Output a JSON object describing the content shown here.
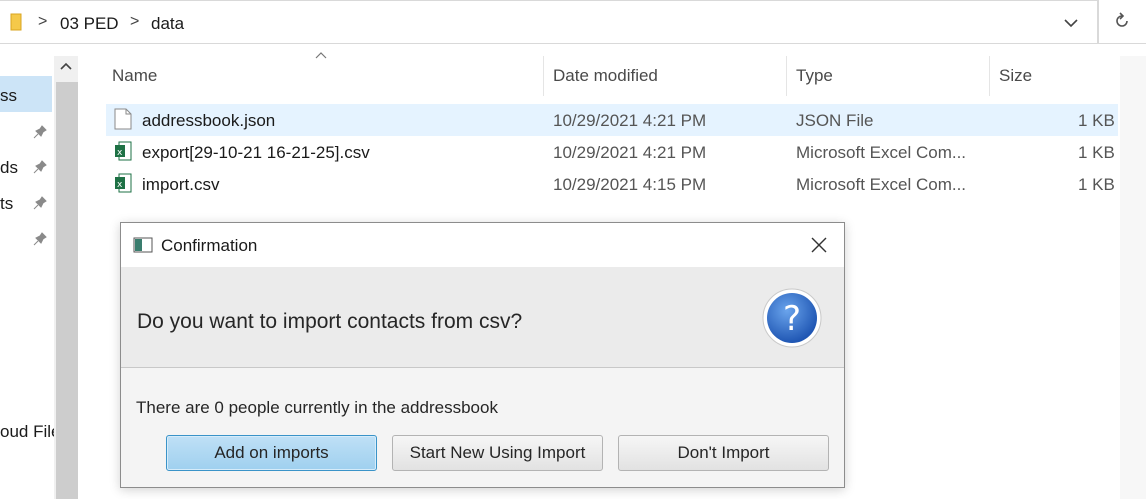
{
  "addressbar": {
    "crumbs": [
      "03 PED",
      "data"
    ],
    "separator": ">"
  },
  "nav": {
    "items": [
      {
        "label": "ss",
        "selected": true,
        "pinned": false
      },
      {
        "label": "",
        "pinned": true
      },
      {
        "label": "ds",
        "pinned": true
      },
      {
        "label": "ts",
        "pinned": true
      },
      {
        "label": "",
        "pinned": true
      },
      {
        "label": "oud File",
        "pinned": false
      }
    ]
  },
  "columns": {
    "name": "Name",
    "date": "Date modified",
    "type": "Type",
    "size": "Size"
  },
  "files": [
    {
      "name": "addressbook.json",
      "date": "10/29/2021 4:21 PM",
      "type": "JSON File",
      "size": "1 KB",
      "icon": "document-icon",
      "selected": true
    },
    {
      "name": "export[29-10-21 16-21-25].csv",
      "date": "10/29/2021 4:21 PM",
      "type": "Microsoft Excel Com...",
      "size": "1 KB",
      "icon": "excel-icon",
      "selected": false
    },
    {
      "name": "import.csv",
      "date": "10/29/2021 4:15 PM",
      "type": "Microsoft Excel Com...",
      "size": "1 KB",
      "icon": "excel-icon",
      "selected": false
    }
  ],
  "dialog": {
    "title": "Confirmation",
    "question": "Do you want to import contacts from csv?",
    "info": "There are 0 people currently in the addressbook",
    "buttons": {
      "add": "Add on imports",
      "start_new": "Start New Using Import",
      "dont": "Don't  Import"
    },
    "question_icon": "question-mark-icon"
  },
  "colors": {
    "selection": "#cce4f7",
    "row_selected": "#e5f3ff",
    "default_button": "#9fd0ef",
    "question_icon": "#2f6fc6"
  }
}
